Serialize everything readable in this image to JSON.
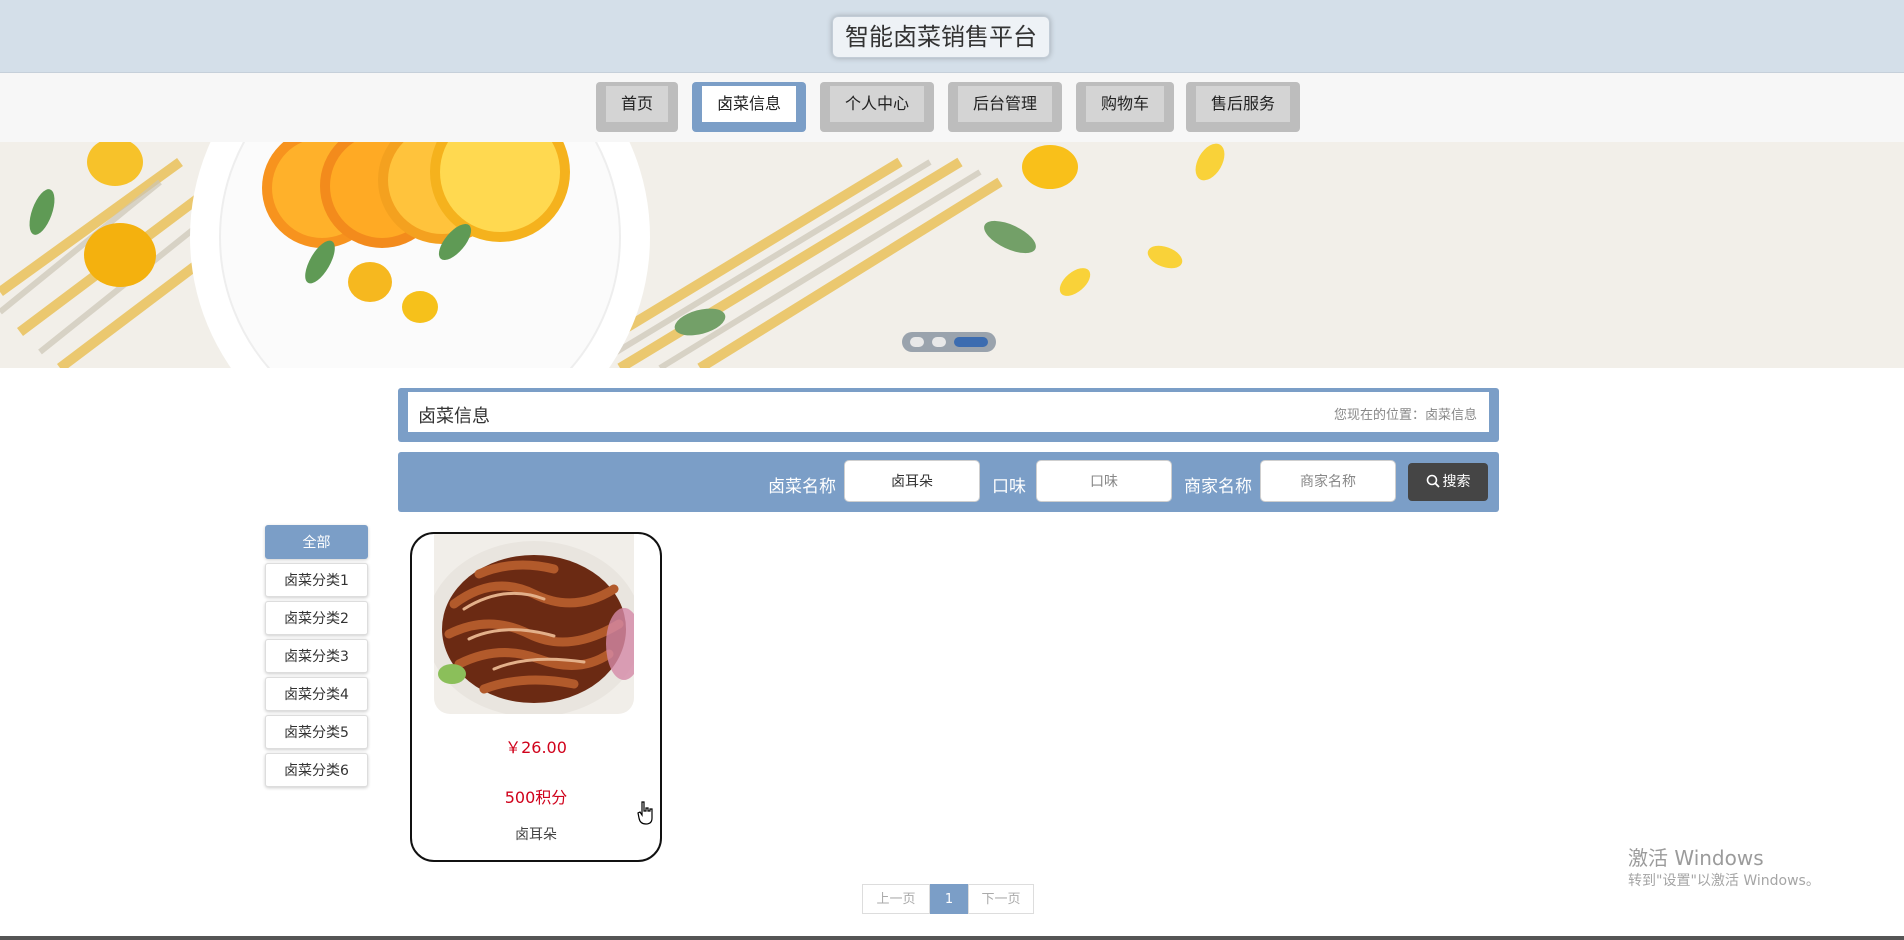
{
  "header": {
    "title": "智能卤菜销售平台"
  },
  "nav": {
    "items": [
      {
        "label": "首页",
        "active": false
      },
      {
        "label": "卤菜信息",
        "active": true
      },
      {
        "label": "个人中心",
        "active": false
      },
      {
        "label": "后台管理",
        "active": false
      },
      {
        "label": "购物车",
        "active": false
      },
      {
        "label": "售后服务",
        "active": false
      }
    ]
  },
  "banner": {
    "slide_count": 3,
    "active_slide": 3
  },
  "section": {
    "title": "卤菜信息",
    "breadcrumb": "您现在的位置：卤菜信息"
  },
  "search": {
    "name_label": "卤菜名称",
    "name_value": "卤耳朵",
    "flavor_label": "口味",
    "flavor_placeholder": "口味",
    "merchant_label": "商家名称",
    "merchant_placeholder": "商家名称",
    "button_label": "搜索",
    "button_icon": "search-icon"
  },
  "categories": [
    "全部",
    "卤菜分类1",
    "卤菜分类2",
    "卤菜分类3",
    "卤菜分类4",
    "卤菜分类5",
    "卤菜分类6"
  ],
  "active_category": 0,
  "product": {
    "price": "￥26.00",
    "points": "500积分",
    "name": "卤耳朵"
  },
  "pagination": {
    "prev": "上一页",
    "current": "1",
    "next": "下一页"
  },
  "watermark": {
    "line1": "激活 Windows",
    "line2": "转到\"设置\"以激活 Windows。"
  },
  "colors": {
    "accent": "#7b9ec7",
    "header_bg": "#d4dfe9",
    "price": "#d0021b",
    "dark_button": "#454545"
  }
}
